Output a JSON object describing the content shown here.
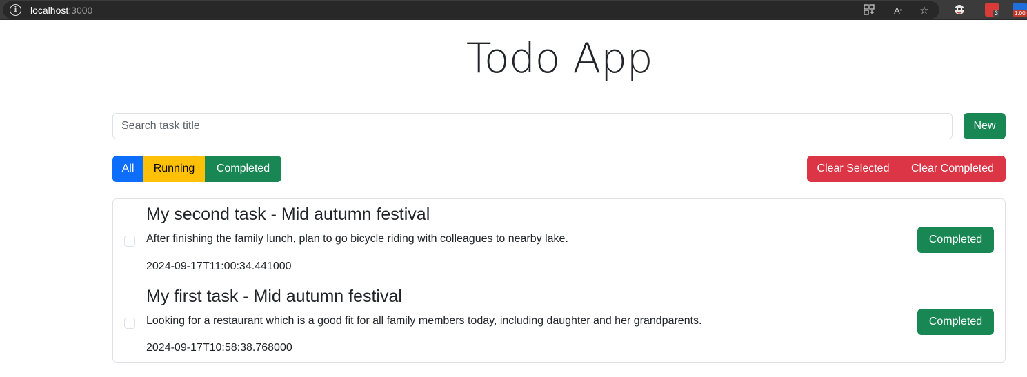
{
  "browser": {
    "url_host": "localhost",
    "url_port": ":3000",
    "extension_badges": [
      "3",
      "1.00"
    ]
  },
  "app": {
    "title": "Todo App",
    "search": {
      "placeholder": "Search task title",
      "value": ""
    },
    "new_label": "New",
    "filters": {
      "all": "All",
      "running": "Running",
      "completed": "Completed"
    },
    "actions": {
      "clear_selected": "Clear Selected",
      "clear_completed": "Clear Completed"
    },
    "tasks": [
      {
        "title": "My second task - Mid autumn festival",
        "description": "After finishing the family lunch, plan to go bicycle riding with colleagues to nearby lake.",
        "timestamp": "2024-09-17T11:00:34.441000",
        "status_label": "Completed",
        "checked": false
      },
      {
        "title": "My first task - Mid autumn festival",
        "description": "Looking for a restaurant which is a good fit for all family members today, including daughter and her grandparents.",
        "timestamp": "2024-09-17T10:58:38.768000",
        "status_label": "Completed",
        "checked": false
      }
    ]
  },
  "colors": {
    "primary": "#0d6efd",
    "warning": "#ffc107",
    "success": "#198754",
    "danger": "#dc3545",
    "border": "#dee2e6"
  }
}
